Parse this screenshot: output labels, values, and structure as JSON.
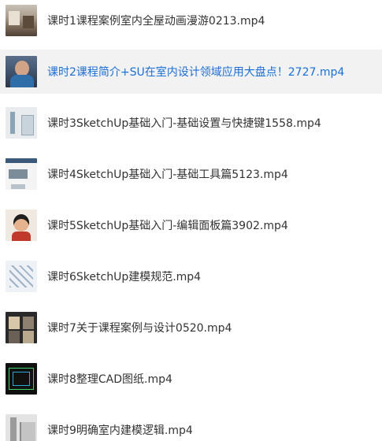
{
  "lessons": [
    {
      "title": "课时1课程案例室内全屋动画漫游0213.mp4",
      "thumbnail_icon": "video-thumbnail",
      "active": false
    },
    {
      "title": "课时2课程简介+SU在室内设计领域应用大盘点！2727.mp4",
      "thumbnail_icon": "video-thumbnail",
      "active": true
    },
    {
      "title": "课时3SketchUp基础入门-基础设置与快捷键1558.mp4",
      "thumbnail_icon": "video-thumbnail",
      "active": false
    },
    {
      "title": "课时4SketchUp基础入门-基础工具篇5123.mp4",
      "thumbnail_icon": "video-thumbnail",
      "active": false
    },
    {
      "title": "课时5SketchUp基础入门-编辑面板篇3902.mp4",
      "thumbnail_icon": "video-thumbnail",
      "active": false
    },
    {
      "title": "课时6SketchUp建模规范.mp4",
      "thumbnail_icon": "video-thumbnail",
      "active": false
    },
    {
      "title": "课时7关于课程案例与设计0520.mp4",
      "thumbnail_icon": "video-thumbnail",
      "active": false
    },
    {
      "title": "课时8整理CAD图纸.mp4",
      "thumbnail_icon": "video-thumbnail",
      "active": false
    },
    {
      "title": "课时9明确室内建模逻辑.mp4",
      "thumbnail_icon": "video-thumbnail",
      "active": false
    }
  ],
  "colors": {
    "active_text": "#1a6fd6",
    "active_row_bg": "#f2f2f2",
    "text": "#333333"
  }
}
